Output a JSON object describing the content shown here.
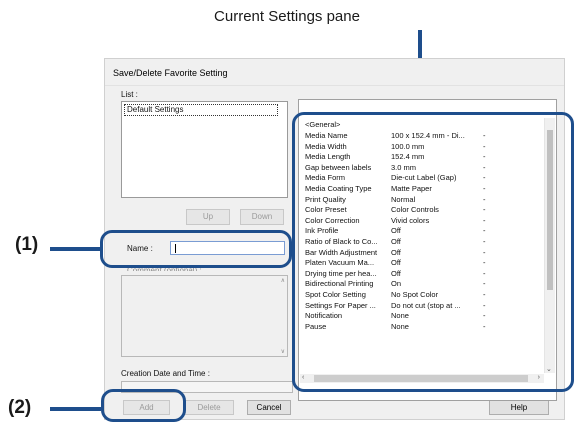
{
  "annotation": {
    "pane_label": "Current Settings pane",
    "marker_1": "(1)",
    "marker_2": "(2)",
    "accent_color": "#1e4e8c"
  },
  "dialog": {
    "title": "Save/Delete Favorite Setting",
    "list_label": "List :",
    "list_items": [
      "Default Settings"
    ],
    "up_label": "Up",
    "down_label": "Down",
    "name_label": "Name :",
    "name_value": "",
    "comment_label": "Comment (optional) :",
    "creation_label": "Creation Date and Time :",
    "add_label": "Add",
    "delete_label": "Delete",
    "cancel_label": "Cancel",
    "help_label": "Help"
  },
  "settings": {
    "group": "<General>",
    "rows": [
      {
        "name": "Media Name",
        "value": "100 x 152.4 mm - Di...",
        "flag": "-"
      },
      {
        "name": "Media Width",
        "value": "100.0 mm",
        "flag": "-"
      },
      {
        "name": "Media Length",
        "value": "152.4 mm",
        "flag": "-"
      },
      {
        "name": "Gap between labels",
        "value": "3.0 mm",
        "flag": "-"
      },
      {
        "name": "Media Form",
        "value": "Die-cut Label (Gap)",
        "flag": "-"
      },
      {
        "name": "Media Coating Type",
        "value": "Matte Paper",
        "flag": "-"
      },
      {
        "name": "Print Quality",
        "value": "Normal",
        "flag": "-"
      },
      {
        "name": "Color Preset",
        "value": "Color Controls",
        "flag": "-"
      },
      {
        "name": "Color Correction",
        "value": "Vivid colors",
        "flag": "-"
      },
      {
        "name": "Ink Profile",
        "value": "Off",
        "flag": "-"
      },
      {
        "name": "Ratio of Black to Co...",
        "value": "Off",
        "flag": "-"
      },
      {
        "name": "Bar Width Adjustment",
        "value": "Off",
        "flag": "-"
      },
      {
        "name": "Platen Vacuum Ma...",
        "value": "Off",
        "flag": "-"
      },
      {
        "name": "Drying time per hea...",
        "value": "Off",
        "flag": "-"
      },
      {
        "name": "Bidirectional Printing",
        "value": "On",
        "flag": "-"
      },
      {
        "name": "Spot Color Setting",
        "value": "No Spot Color",
        "flag": "-"
      },
      {
        "name": "Settings For Paper ...",
        "value": "Do not cut (stop at ...",
        "flag": "-"
      },
      {
        "name": "Notification",
        "value": "None",
        "flag": "-"
      },
      {
        "name": "Pause",
        "value": "None",
        "flag": "-"
      }
    ]
  }
}
